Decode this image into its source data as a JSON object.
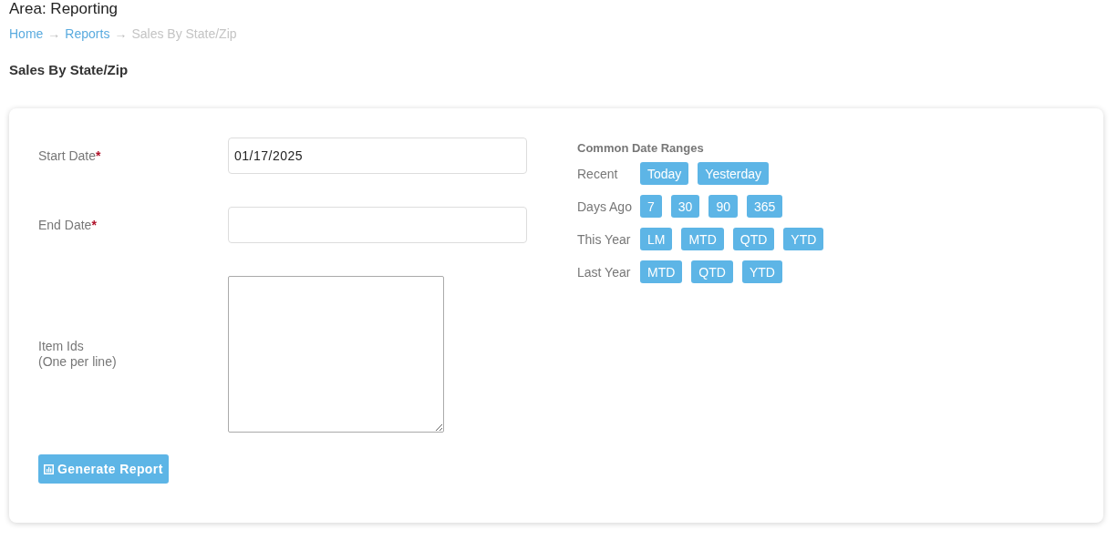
{
  "area_title": "Area: Reporting",
  "breadcrumb": [
    {
      "label": "Home",
      "kind": "link"
    },
    {
      "label": "→",
      "kind": "separator"
    },
    {
      "label": "Reports",
      "kind": "link"
    },
    {
      "label": "→",
      "kind": "separator"
    },
    {
      "label": "Sales By State/Zip",
      "kind": "current"
    }
  ],
  "page_heading": "Sales By State/Zip",
  "form": {
    "fields": [
      {
        "label": "Start Date",
        "required": true,
        "kind": "input",
        "value": "01/17/2025"
      },
      {
        "label": "End Date",
        "required": true,
        "kind": "input"
      },
      {
        "label": "Item Ids",
        "hint": "(One per line)",
        "required": false,
        "kind": "textarea"
      }
    ],
    "required_mark": "*",
    "submit_button": "Generate Report"
  },
  "date_ranges": {
    "title": "Common Date Ranges",
    "groups": [
      {
        "label": "Recent",
        "buttons": [
          "Today",
          "Yesterday"
        ]
      },
      {
        "label": "Days Ago",
        "buttons": [
          "7",
          "30",
          "90",
          "365"
        ]
      },
      {
        "label": "This Year",
        "buttons": [
          "LM",
          "MTD",
          "QTD",
          "YTD"
        ]
      },
      {
        "label": "Last Year",
        "buttons": [
          "MTD",
          "QTD",
          "YTD"
        ]
      }
    ]
  }
}
